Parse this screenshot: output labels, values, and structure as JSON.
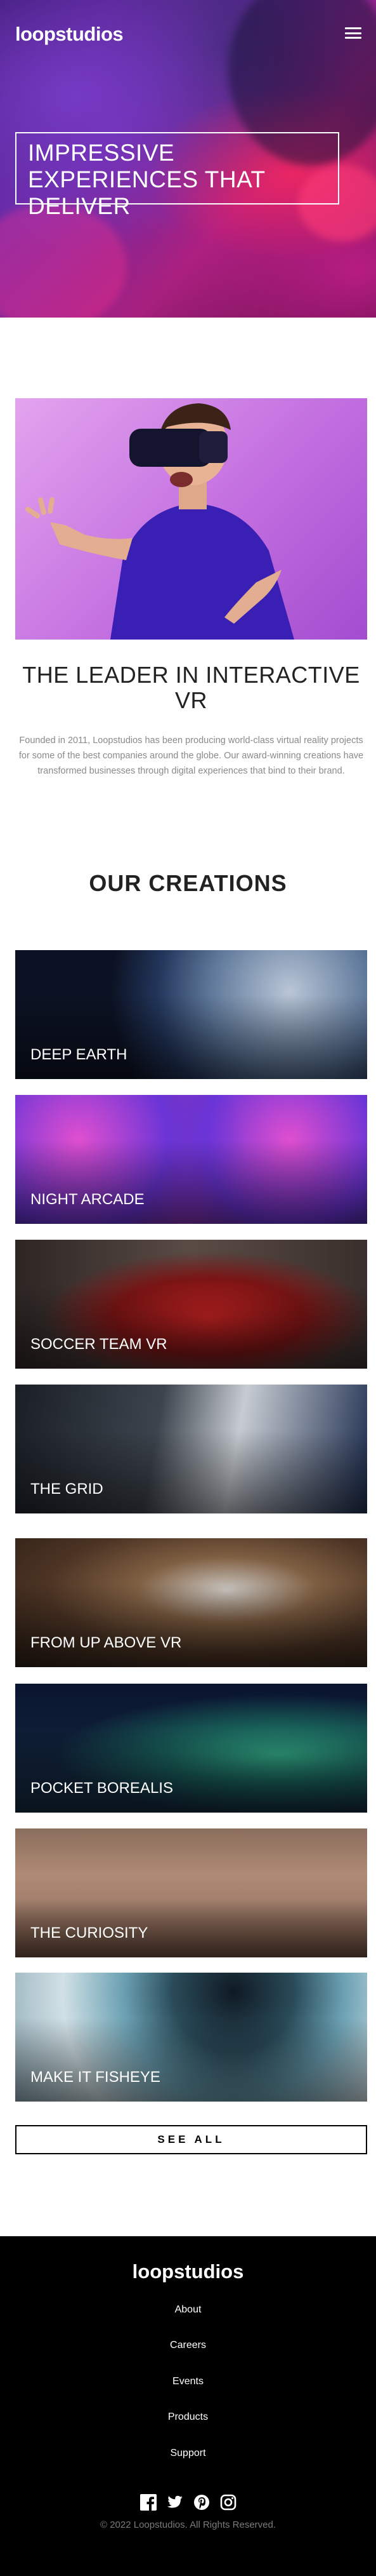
{
  "header": {
    "logo": "loopstudios",
    "menu_icon": "hamburger-menu-icon"
  },
  "hero": {
    "title": "Impressive experiences that deliver"
  },
  "interactive": {
    "title": "The leader in interactive VR",
    "text": "Founded in 2011, Loopstudios has been producing world-class virtual reality projects for some of the best companies around the globe. Our award-winning creations have transformed businesses through digital experiences that bind to their brand."
  },
  "creations": {
    "title": "Our creations",
    "items": [
      {
        "label": "Deep earth"
      },
      {
        "label": "Night arcade"
      },
      {
        "label": "Soccer team VR"
      },
      {
        "label": "The grid"
      },
      {
        "label": "From up above VR"
      },
      {
        "label": "Pocket borealis"
      },
      {
        "label": "The curiosity"
      },
      {
        "label": "Make it fisheye"
      }
    ],
    "see_all": "See all"
  },
  "footer": {
    "logo": "loopstudios",
    "nav": [
      "About",
      "Careers",
      "Events",
      "Products",
      "Support"
    ],
    "socials": [
      "facebook-icon",
      "twitter-icon",
      "pinterest-icon",
      "instagram-icon"
    ],
    "copyright": "© 2022 Loopstudios. All Rights Reserved."
  }
}
